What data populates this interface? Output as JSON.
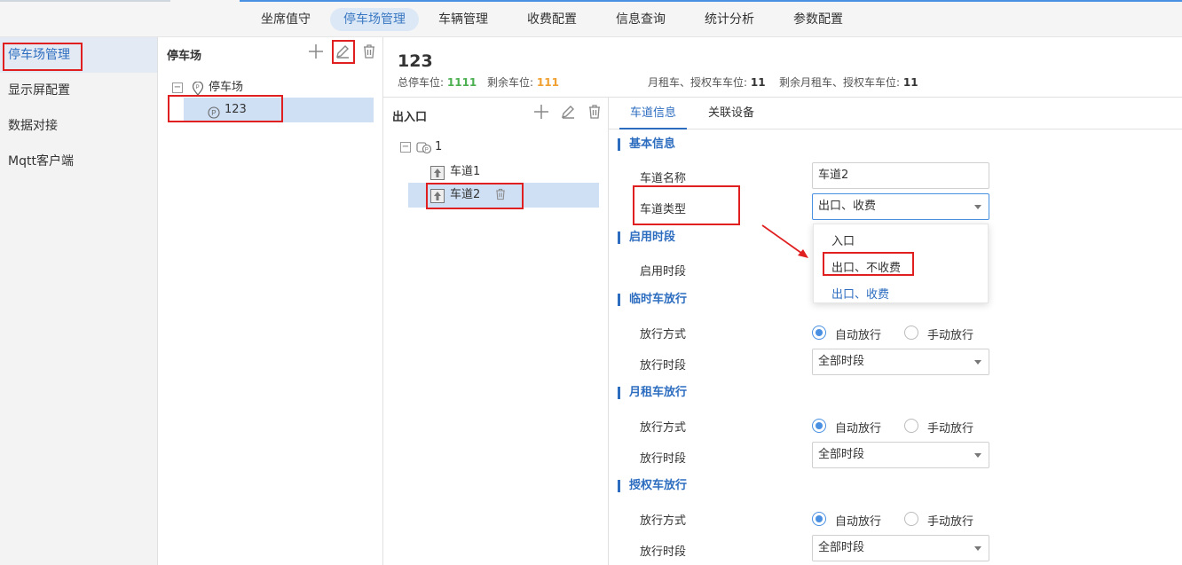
{
  "topnav": {
    "items": [
      "坐席值守",
      "停车场管理",
      "车辆管理",
      "收费配置",
      "信息查询",
      "统计分析",
      "参数配置"
    ],
    "active": "停车场管理"
  },
  "sidebar": {
    "items": [
      "停车场管理",
      "显示屏配置",
      "数据对接",
      "Mqtt客户端"
    ]
  },
  "lot_tree": {
    "title": "停车场",
    "root": "停车场",
    "child": "123"
  },
  "header": {
    "name": "123",
    "total_label": "总停车位:",
    "total_value": "1111",
    "remain_label": "剩余车位:",
    "remain_value": "111",
    "monthly_label": "月租车、授权车车位:",
    "monthly_value": "11",
    "monthly_remain_label": "剩余月租车、授权车车位:",
    "monthly_remain_value": "11"
  },
  "gate_tree": {
    "title": "出入口",
    "root": "1",
    "lanes": [
      "车道1",
      "车道2"
    ]
  },
  "tabs": [
    "车道信息",
    "关联设备"
  ],
  "form": {
    "basic_section": "基本信息",
    "lane_name_label": "车道名称",
    "lane_name_value": "车道2",
    "lane_type_label": "车道类型",
    "lane_type_value": "出口、收费",
    "enable_section": "启用时段",
    "enable_label": "启用时段",
    "temp_section": "临时车放行",
    "monthly_section": "月租车放行",
    "auth_section": "授权车放行",
    "release_mode_label": "放行方式",
    "release_time_label": "放行时段",
    "auto_release": "自动放行",
    "manual_release": "手动放行",
    "all_time": "全部时段"
  },
  "dropdown_options": [
    "入口",
    "出口、不收费",
    "出口、收费"
  ],
  "colors": {
    "accent": "#2d6dc0",
    "total_value": "#4caf50",
    "remain_value": "#f0a030",
    "annotation": "#e02020"
  }
}
